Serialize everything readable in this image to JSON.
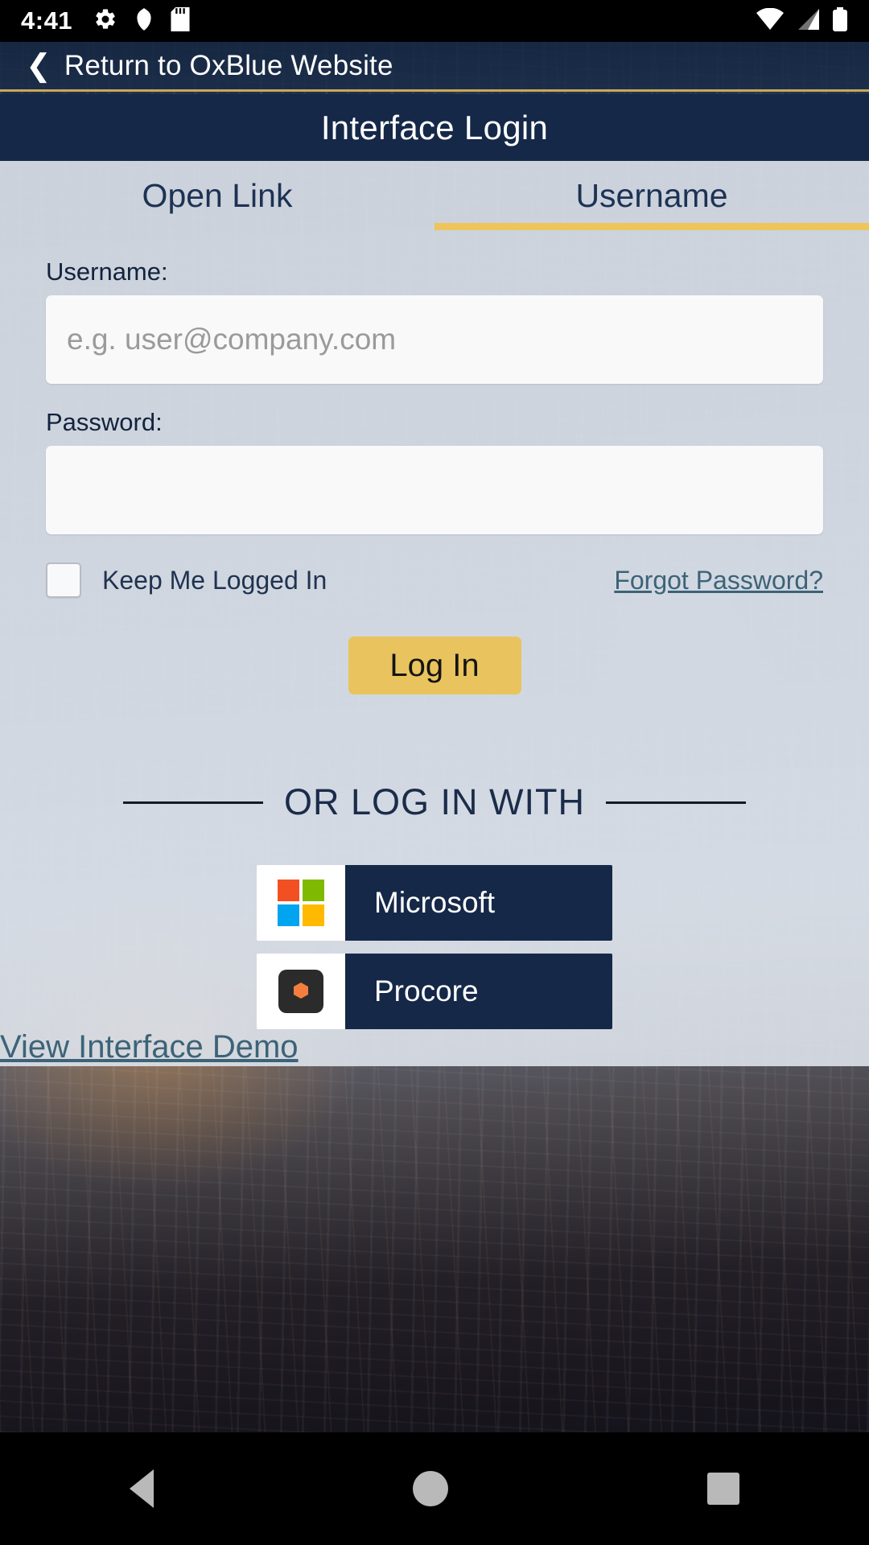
{
  "status_bar": {
    "time": "4:41",
    "left_icons": [
      "gear-icon",
      "shield-icon",
      "sd-card-icon"
    ],
    "right_icons": [
      "wifi-icon",
      "cellular-signal-icon",
      "battery-icon"
    ]
  },
  "return_bar": {
    "back_icon": "chevron-left-icon",
    "label": "Return to OxBlue Website"
  },
  "header": {
    "title": "Interface Login"
  },
  "tabs": [
    {
      "label": "Open Link",
      "active": false
    },
    {
      "label": "Username",
      "active": true
    }
  ],
  "form": {
    "username_label": "Username:",
    "username_value": "",
    "username_placeholder": "e.g. user@company.com",
    "password_label": "Password:",
    "password_value": "",
    "password_placeholder": "",
    "keep_logged_in_label": "Keep Me Logged In",
    "keep_logged_in_checked": false,
    "forgot_password_label": "Forgot Password?",
    "login_button_label": "Log In"
  },
  "divider": {
    "label": "OR LOG IN WITH"
  },
  "sso_buttons": [
    {
      "label": "Microsoft",
      "logo": "microsoft-logo-icon"
    },
    {
      "label": "Procore",
      "logo": "procore-logo-icon"
    }
  ],
  "demo": {
    "label": "View Interface Demo"
  },
  "nav_bar": {
    "back": "back-triangle-icon",
    "home": "home-circle-icon",
    "recents": "recents-square-icon"
  },
  "colors": {
    "navy": "#152848",
    "gold": "#e9c45e",
    "gold_border": "#c8a85a",
    "panel": "#dee3eb",
    "link_teal": "#3c6378",
    "ms_red": "#f25022",
    "ms_green": "#7fba00",
    "ms_blue": "#00a4ef",
    "ms_yellow": "#ffb900",
    "procore_dark": "#2b2b2b",
    "procore_orange": "#f47e3e"
  }
}
